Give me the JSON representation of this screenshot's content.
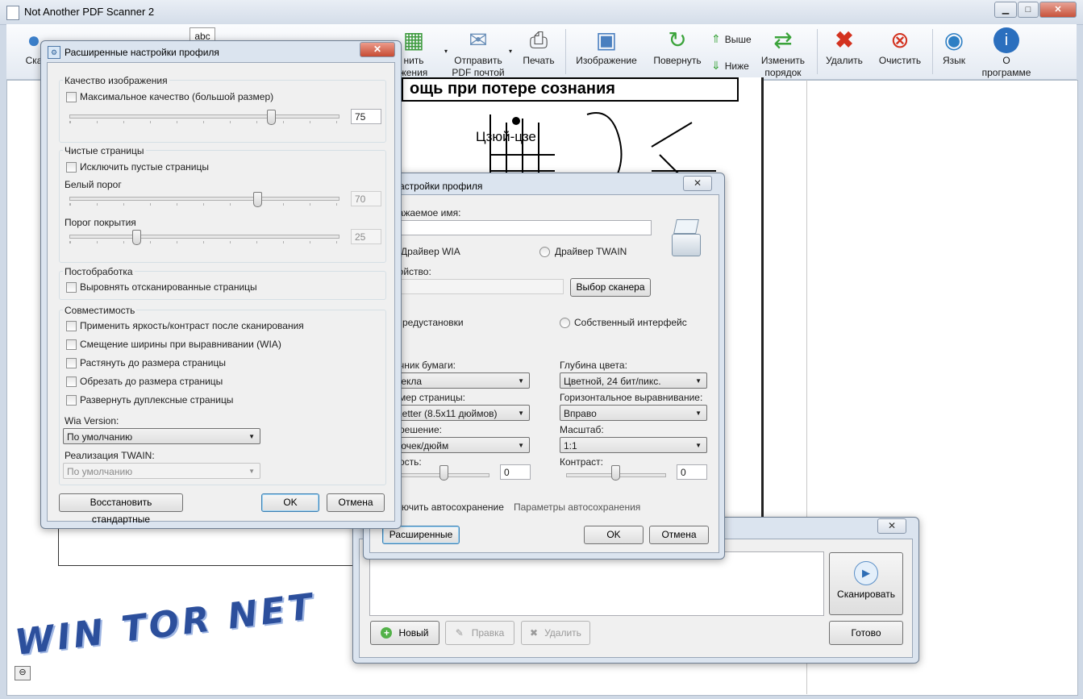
{
  "app": {
    "title": "Not Another PDF Scanner 2",
    "minimize": "▁",
    "maximize": "□",
    "close": "✕"
  },
  "toolbar": {
    "scan": "Ска",
    "save": "нить\nжения",
    "email": "Отправить\nPDF почтой",
    "print": "Печать",
    "image": "Изображение",
    "rotate": "Повернуть",
    "up": "Выше",
    "down": "Ниже",
    "reorder": "Изменить\nпорядок",
    "delete": "Удалить",
    "clear": "Очистить",
    "language": "Язык",
    "about": "О\nпрограмме",
    "abc_text": "abc"
  },
  "scan_page": {
    "heading": "ощь при потере сознания",
    "caption": "Цзюй-цзе"
  },
  "watermark": "WIN TOR NET",
  "advanced_dialog": {
    "title": "Расширенные настройки профиля",
    "quality_group": "Качество изображения",
    "max_quality": "Максимальное качество (большой размер)",
    "quality_value": "75",
    "quality_level": 0.75,
    "blank_group": "Чистые страницы",
    "exclude_blank": "Исключить пустые страницы",
    "white_threshold_label": "Белый порог",
    "white_threshold_value": "70",
    "white_threshold_level": 0.7,
    "coverage_label": "Порог покрытия",
    "coverage_value": "25",
    "coverage_level": 0.25,
    "post_group": "Постобработка",
    "deskew": "Выровнять отсканированные страницы",
    "compat_group": "Совместимость",
    "apply_brightness": "Применить яркость/контраст после сканирования",
    "width_offset": "Смещение ширины при выравнивании (WIA)",
    "stretch": "Растянуть до размера страницы",
    "crop": "Обрезать до размера страницы",
    "duplex": "Развернуть дуплексные страницы",
    "wia_version_label": "Wia Version:",
    "wia_version_value": "По умолчанию",
    "twain_label": "Реализация TWAIN:",
    "twain_value": "По умолчанию",
    "restore_defaults": "Восстановить стандартные",
    "ok": "OK",
    "cancel": "Отмена"
  },
  "profile_dialog": {
    "title": "астройки профиля",
    "display_name_label": "ражаемое имя:",
    "display_name_value": "",
    "driver_wia": "Драйвер WIA",
    "driver_twain": "Драйвер TWAIN",
    "device_label": "ройство:",
    "choose_scanner": "Выбор сканера",
    "presets": "редустановки",
    "native_ui": "Собственный интерфейс",
    "paper_source_label": "чник бумаги:",
    "paper_source_value": "текла",
    "color_depth_label": "Глубина цвета:",
    "color_depth_value": "Цветной, 24 бит/пикс.",
    "page_size_label": "мер страницы:",
    "page_size_value": "Letter (8.5x11 дюймов)",
    "h_align_label": "Горизонтальное выравнивание:",
    "h_align_value": "Вправо",
    "resolution_label": "решение:",
    "resolution_value": "точек/дюйм",
    "scale_label": "Масштаб:",
    "scale_value": "1:1",
    "brightness_label": "ость:",
    "brightness_value": "0",
    "brightness_level": 0.5,
    "contrast_label": "Контраст:",
    "contrast_value": "0",
    "contrast_level": 0.5,
    "autosave": "лючить автосохранение",
    "autosave_params": "Параметры автосохранения",
    "advanced": "Расширенные",
    "ok": "OK",
    "cancel": "Отмена"
  },
  "profiles_dialog": {
    "close": "✕",
    "scan": "Сканировать",
    "new": "Новый",
    "edit": "Правка",
    "delete": "Удалить",
    "done": "Готово"
  }
}
